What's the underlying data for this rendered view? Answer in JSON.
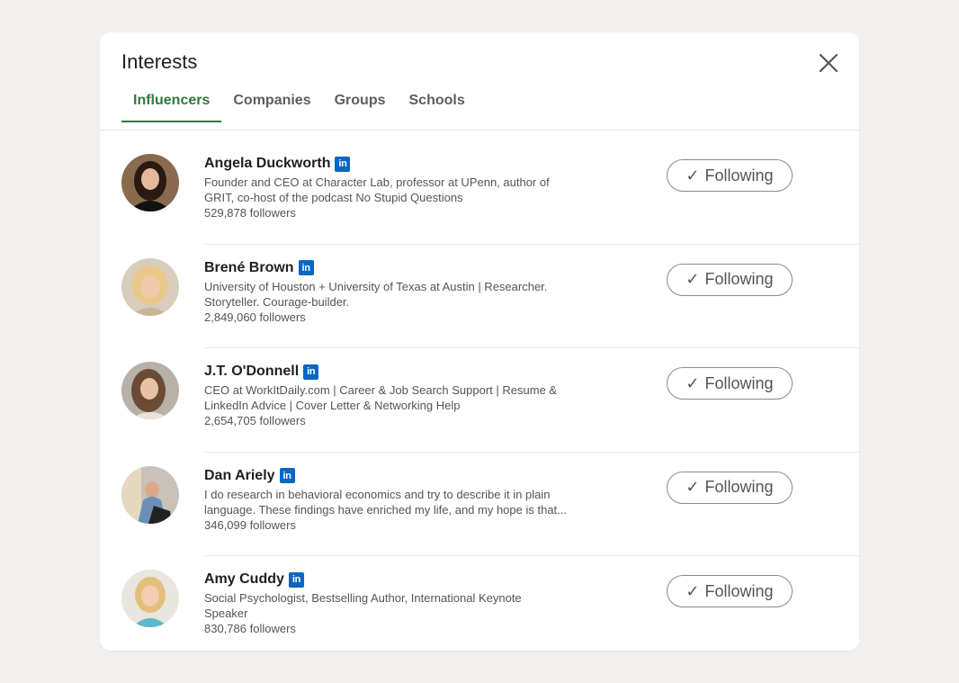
{
  "modal": {
    "title": "Interests",
    "close_icon": "close-icon"
  },
  "tabs": [
    {
      "label": "Influencers",
      "active": true
    },
    {
      "label": "Companies",
      "active": false
    },
    {
      "label": "Groups",
      "active": false
    },
    {
      "label": "Schools",
      "active": false
    }
  ],
  "colors": {
    "active_tab": "#2f7a3b",
    "linkedin_badge": "#0a66c2",
    "background": "#f1f0ee"
  },
  "influencers": [
    {
      "name": "Angela Duckworth",
      "badge": "in",
      "headline_1": "Founder and CEO at Character Lab, professor at UPenn, author of",
      "headline_2": "GRIT, co-host of the podcast No Stupid Questions",
      "followers": "529,878 followers",
      "button_check": "✓",
      "button_label": "Following"
    },
    {
      "name": "Brené Brown",
      "badge": "in",
      "headline_1": "University of Houston + University of Texas at Austin | Researcher.",
      "headline_2": "Storyteller. Courage-builder.",
      "followers": "2,849,060 followers",
      "button_check": "✓",
      "button_label": "Following"
    },
    {
      "name": "J.T. O'Donnell",
      "badge": "in",
      "headline_1": "CEO at WorkItDaily.com | Career & Job Search Support | Resume &",
      "headline_2": "LinkedIn Advice | Cover Letter & Networking Help",
      "followers": "2,654,705 followers",
      "button_check": "✓",
      "button_label": "Following"
    },
    {
      "name": "Dan Ariely",
      "badge": "in",
      "headline_1": "I do research in behavioral economics and try to describe it in plain",
      "headline_2": "language. These findings have enriched my life, and my hope is that...",
      "followers": "346,099 followers",
      "button_check": "✓",
      "button_label": "Following"
    },
    {
      "name": "Amy Cuddy",
      "badge": "in",
      "headline_1": "Social Psychologist, Bestselling Author, International Keynote",
      "headline_2": "Speaker",
      "followers": "830,786 followers",
      "button_check": "✓",
      "button_label": "Following"
    }
  ]
}
